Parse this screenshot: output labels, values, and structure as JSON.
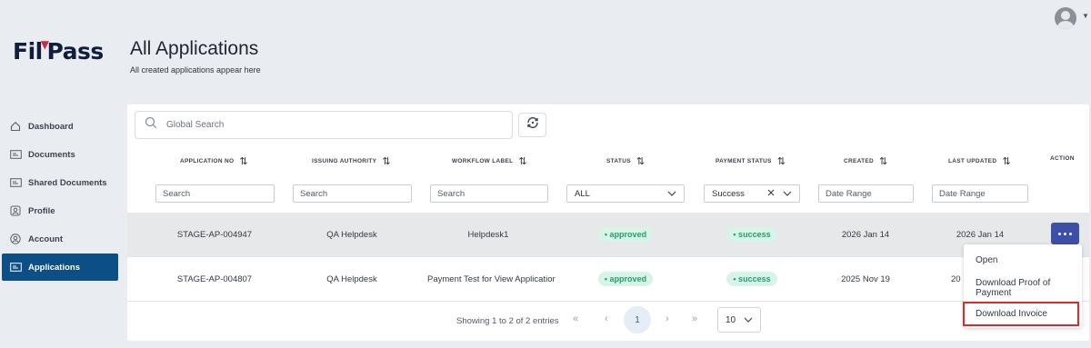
{
  "app": {
    "logo_text_left": "Fil",
    "logo_text_right": "ass",
    "logo_letter": "P"
  },
  "page": {
    "title": "All Applications",
    "subtitle": "All created applications appear here"
  },
  "sidebar": {
    "items": [
      {
        "label": "Dashboard",
        "icon": "home-icon"
      },
      {
        "label": "Documents",
        "icon": "document-icon"
      },
      {
        "label": "Shared Documents",
        "icon": "shared-document-icon"
      },
      {
        "label": "Profile",
        "icon": "profile-icon"
      },
      {
        "label": "Account",
        "icon": "account-icon"
      },
      {
        "label": "Applications",
        "icon": "applications-icon",
        "active": true
      }
    ]
  },
  "search": {
    "placeholder": "Global Search"
  },
  "table": {
    "columns": [
      "APPLICATION NO",
      "ISSUING AUTHORITY",
      "WORKFLOW LABEL",
      "STATUS",
      "PAYMENT STATUS",
      "CREATED",
      "LAST UPDATED",
      "ACTION"
    ],
    "filters": {
      "application_no": "Search",
      "issuing_authority": "Search",
      "workflow_label": "Search",
      "status": "ALL",
      "payment_status": "Success",
      "created": "Date Range",
      "last_updated": "Date Range"
    },
    "rows": [
      {
        "application_no": "STAGE-AP-004947",
        "issuing_authority": "QA Helpdesk",
        "workflow_label": "Helpdesk1",
        "status": "• approved",
        "payment_status": "• success",
        "created": "2026 Jan 14",
        "last_updated": "2026 Jan 14"
      },
      {
        "application_no": "STAGE-AP-004807",
        "issuing_authority": "QA Helpdesk",
        "workflow_label": "Payment Test for View Applicatior",
        "status": "• approved",
        "payment_status": "• success",
        "created": "2025 Nov 19",
        "last_updated": "20"
      }
    ]
  },
  "pagination": {
    "summary": "Showing 1 to 2 of 2 entries",
    "current_page": "1",
    "page_size": "10",
    "first": "«",
    "prev": "‹",
    "next": "›",
    "last": "»"
  },
  "action_menu": {
    "items": [
      "Open",
      "Download Proof of Payment",
      "Download Invoice"
    ],
    "highlighted": "Download Invoice"
  },
  "colors": {
    "accent": "#0b4f86",
    "action_button": "#3d4fa6",
    "success_bg": "#d8f3e7",
    "success_text": "#23a26b",
    "highlight_border": "#e0292b"
  }
}
